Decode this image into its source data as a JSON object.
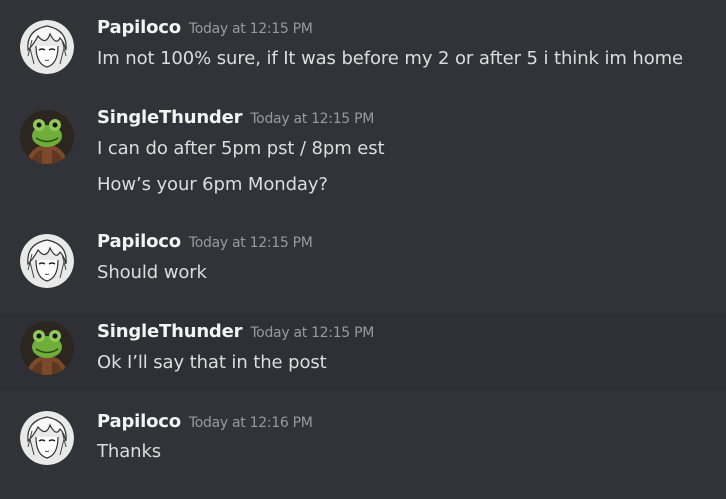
{
  "messages": [
    {
      "username": "Papiloco",
      "timestamp": "Today at 12:15 PM",
      "avatar_icon": "anime-portrait-avatar",
      "lines": [
        "Im not 100% sure, if It was before my 2 or after 5 i think im home"
      ]
    },
    {
      "username": "SingleThunder",
      "timestamp": "Today at 12:15 PM",
      "avatar_icon": "kermit-frog-avatar",
      "lines": [
        "I can do after 5pm pst / 8pm est",
        "How’s your 6pm Monday?"
      ]
    },
    {
      "username": "Papiloco",
      "timestamp": "Today at 12:15 PM",
      "avatar_icon": "anime-portrait-avatar",
      "lines": [
        "Should work"
      ]
    },
    {
      "username": "SingleThunder",
      "timestamp": "Today at 12:15 PM",
      "avatar_icon": "kermit-frog-avatar",
      "lines": [
        "Ok I’ll say that in the post"
      ]
    },
    {
      "username": "Papiloco",
      "timestamp": "Today at 12:16 PM",
      "avatar_icon": "anime-portrait-avatar",
      "lines": [
        "Thanks"
      ]
    }
  ],
  "colors": {
    "background": "#313338",
    "hover_background": "#2e3035",
    "username": "#f2f3f5",
    "timestamp": "#949ba4",
    "message_text": "#dbdee1"
  }
}
